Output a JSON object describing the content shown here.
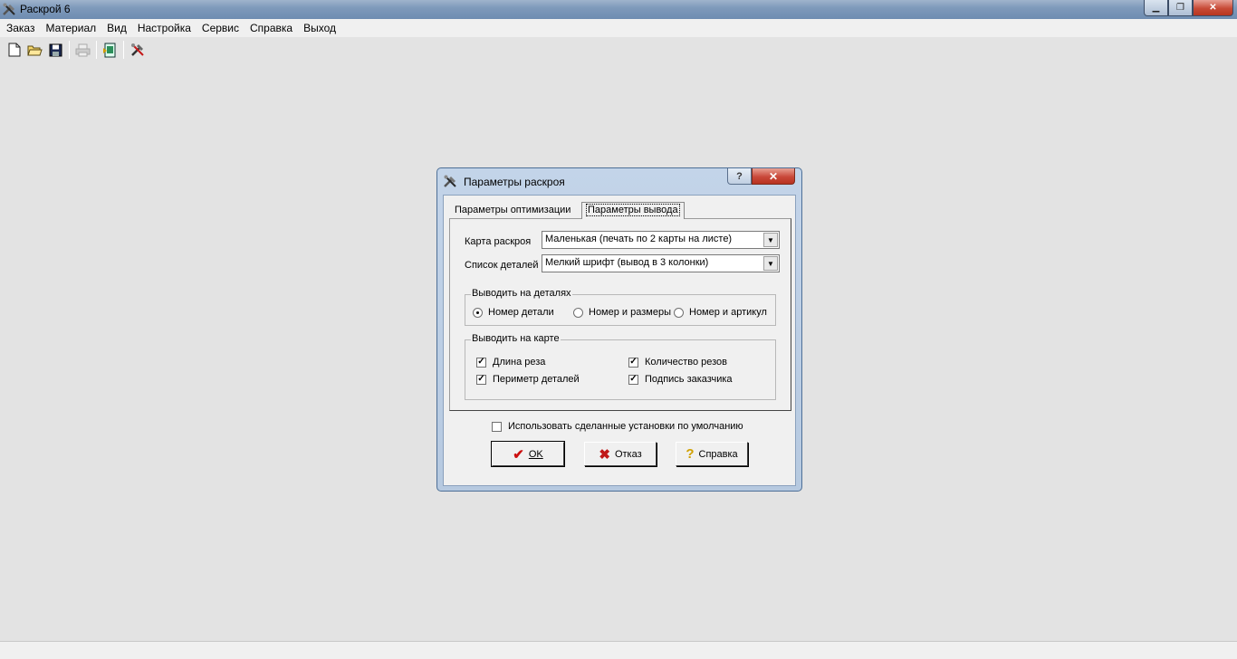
{
  "window": {
    "title": "Раскрой 6",
    "controls": {
      "minimize": "▁",
      "maximize": "❐",
      "close": "✕"
    }
  },
  "menu": [
    "Заказ",
    "Материал",
    "Вид",
    "Настройка",
    "Сервис",
    "Справка",
    "Выход"
  ],
  "toolbar": {
    "icons": [
      "new-file-icon",
      "open-folder-icon",
      "save-icon",
      "print-icon",
      "export-icon",
      "settings-icon"
    ],
    "print_disabled": true
  },
  "dialog": {
    "title": "Параметры раскроя",
    "help_glyph": "?",
    "close_glyph": "✕",
    "tabs": [
      "Параметры оптимизации",
      "Параметры вывода"
    ],
    "active_tab": "Параметры вывода",
    "cut_map": {
      "label": "Карта раскроя",
      "value": "Маленькая (печать по 2 карты на листе)"
    },
    "parts_list": {
      "label": "Список деталей",
      "value": "Мелкий шрифт (вывод в 3 колонки)"
    },
    "on_parts": {
      "title": "Выводить на деталях",
      "options": [
        {
          "label": "Номер детали",
          "selected": true
        },
        {
          "label": "Номер и размеры",
          "selected": false
        },
        {
          "label": "Номер и артикул",
          "selected": false
        }
      ]
    },
    "on_map": {
      "title": "Выводить на карте",
      "options": [
        {
          "label": "Длина реза",
          "checked": true
        },
        {
          "label": "Периметр деталей",
          "checked": true
        },
        {
          "label": "Количество резов",
          "checked": true
        },
        {
          "label": "Подпись заказчика",
          "checked": true
        }
      ]
    },
    "default_checkbox": {
      "label": "Использовать сделанные установки по умолчанию",
      "checked": false
    },
    "buttons": {
      "ok": "OK",
      "cancel": "Отказ",
      "help": "Справка"
    },
    "colors": {
      "ok_check": "#cc1010",
      "cancel_x": "#c01818",
      "help_q": "#d0a000"
    }
  }
}
